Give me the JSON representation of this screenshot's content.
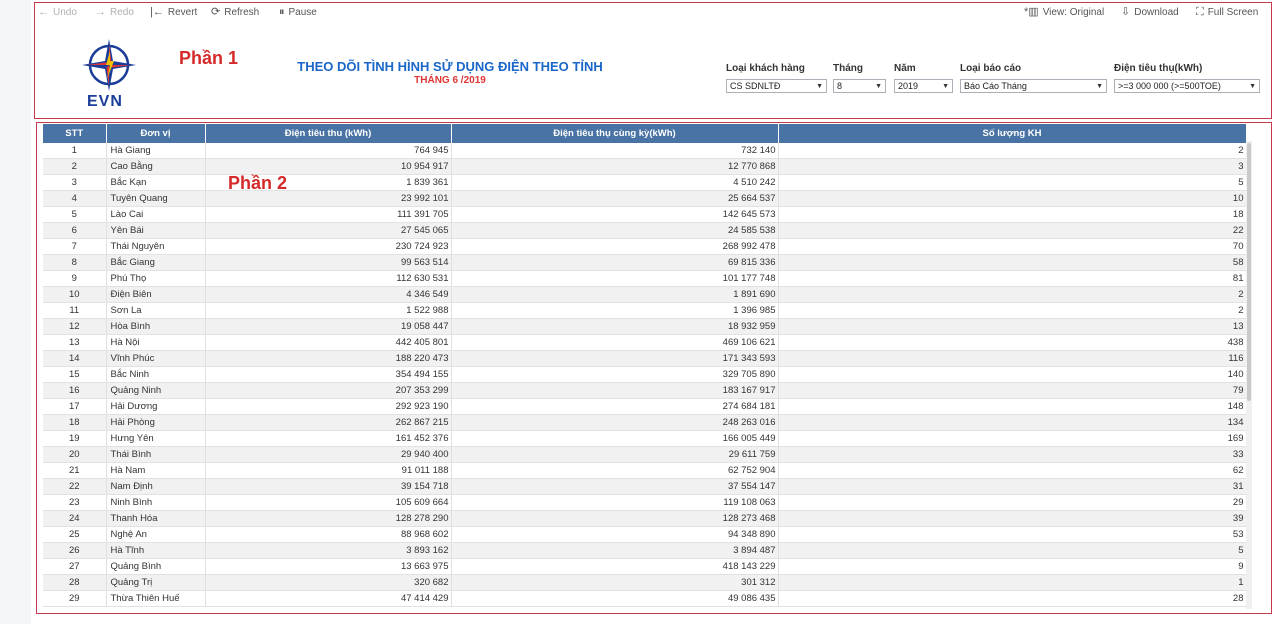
{
  "toolbar": {
    "undo": "Undo",
    "redo": "Redo",
    "revert": "Revert",
    "refresh": "Refresh",
    "pause": "Pause",
    "view": "View: Original",
    "download": "Download",
    "fullscreen": "Full Screen"
  },
  "logo": {
    "text": "EVN"
  },
  "part_labels": {
    "part1": "Phần 1",
    "part2": "Phần 2"
  },
  "header": {
    "title": "THEO DÕI TÌNH HÌNH SỬ DỤNG ĐIỆN THEO TỈNH",
    "subtitle": "THÁNG 6 /2019"
  },
  "filters": [
    {
      "label": "Loại khách hàng",
      "value": "CS SDNLTĐ"
    },
    {
      "label": "Tháng",
      "value": "8"
    },
    {
      "label": "Năm",
      "value": "2019"
    },
    {
      "label": "Loại báo cáo",
      "value": "Báo Cáo Tháng"
    },
    {
      "label": "Điện tiêu thụ(kWh)",
      "value": ">=3 000 000 (>=500TOE)"
    }
  ],
  "table": {
    "columns": [
      "STT",
      "Đơn vị",
      "Điện tiêu thu (kWh)",
      "Điện tiêu thụ cùng kỳ(kWh)",
      "Số lượng KH"
    ],
    "rows": [
      [
        "1",
        "Hà Giang",
        "764 945",
        "732 140",
        "2"
      ],
      [
        "2",
        "Cao Bằng",
        "10 954 917",
        "12 770 868",
        "3"
      ],
      [
        "3",
        "Bắc Kạn",
        "1 839 361",
        "4 510 242",
        "5"
      ],
      [
        "4",
        "Tuyên Quang",
        "23 992 101",
        "25 664 537",
        "10"
      ],
      [
        "5",
        "Lào Cai",
        "111 391 705",
        "142 645 573",
        "18"
      ],
      [
        "6",
        "Yên Bái",
        "27 545 065",
        "24 585 538",
        "22"
      ],
      [
        "7",
        "Thái Nguyên",
        "230 724 923",
        "268 992 478",
        "70"
      ],
      [
        "8",
        "Bắc Giang",
        "99 563 514",
        "69 815 336",
        "58"
      ],
      [
        "9",
        "Phú Thọ",
        "112 630 531",
        "101 177 748",
        "81"
      ],
      [
        "10",
        "Điện Biên",
        "4 346 549",
        "1 891 690",
        "2"
      ],
      [
        "11",
        "Sơn La",
        "1 522 988",
        "1 396 985",
        "2"
      ],
      [
        "12",
        "Hòa Bình",
        "19 058 447",
        "18 932 959",
        "13"
      ],
      [
        "13",
        "Hà Nội",
        "442 405 801",
        "469 106 621",
        "438"
      ],
      [
        "14",
        "Vĩnh Phúc",
        "188 220 473",
        "171 343 593",
        "116"
      ],
      [
        "15",
        "Bắc Ninh",
        "354 494 155",
        "329 705 890",
        "140"
      ],
      [
        "16",
        "Quảng Ninh",
        "207 353 299",
        "183 167 917",
        "79"
      ],
      [
        "17",
        "Hải Dương",
        "292 923 190",
        "274 684 181",
        "148"
      ],
      [
        "18",
        "Hải Phòng",
        "262 867 215",
        "248 263 016",
        "134"
      ],
      [
        "19",
        "Hưng Yên",
        "161 452 376",
        "166 005 449",
        "169"
      ],
      [
        "20",
        "Thái Bình",
        "29 940 400",
        "29 611 759",
        "33"
      ],
      [
        "21",
        "Hà Nam",
        "91 011 188",
        "62 752 904",
        "62"
      ],
      [
        "22",
        "Nam Định",
        "39 154 718",
        "37 554 147",
        "31"
      ],
      [
        "23",
        "Ninh Bình",
        "105 609 664",
        "119 108 063",
        "29"
      ],
      [
        "24",
        "Thanh Hóa",
        "128 278 290",
        "128 273 468",
        "39"
      ],
      [
        "25",
        "Nghệ An",
        "88 968 602",
        "94 348 890",
        "53"
      ],
      [
        "26",
        "Hà Tĩnh",
        "3 893 162",
        "3 894 487",
        "5"
      ],
      [
        "27",
        "Quảng Bình",
        "13 663 975",
        "418 143 229",
        "9"
      ],
      [
        "28",
        "Quảng Trị",
        "320 682",
        "301 312",
        "1"
      ],
      [
        "29",
        "Thừa Thiên Huế",
        "47 414 429",
        "49 086 435",
        "28"
      ]
    ]
  },
  "colors": {
    "header_bg": "#4a73a5",
    "title": "#1b66c9",
    "subtitle": "#e03434",
    "annotation": "#d42a2a",
    "logo_blue": "#1b3d9a"
  }
}
